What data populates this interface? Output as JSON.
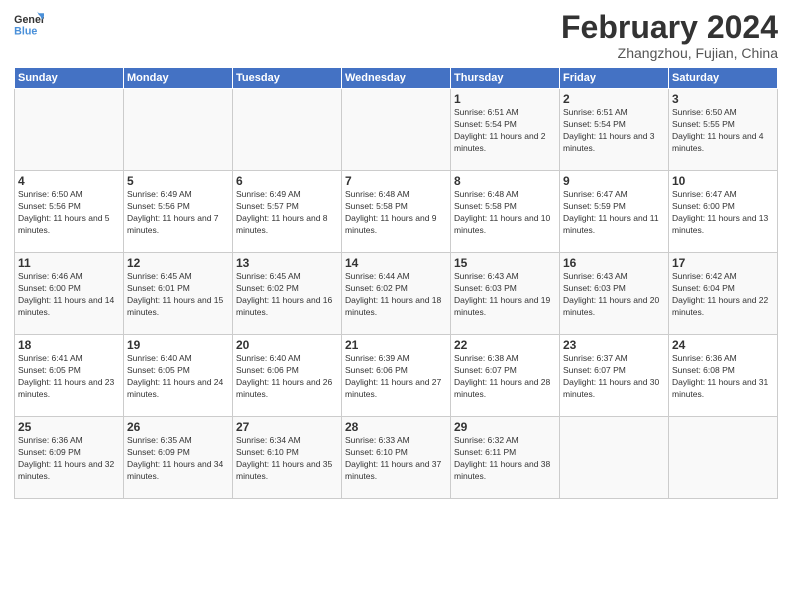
{
  "header": {
    "logo_general": "General",
    "logo_blue": "Blue",
    "title": "February 2024",
    "subtitle": "Zhangzhou, Fujian, China"
  },
  "calendar": {
    "days_of_week": [
      "Sunday",
      "Monday",
      "Tuesday",
      "Wednesday",
      "Thursday",
      "Friday",
      "Saturday"
    ],
    "weeks": [
      [
        {
          "day": "",
          "info": ""
        },
        {
          "day": "",
          "info": ""
        },
        {
          "day": "",
          "info": ""
        },
        {
          "day": "",
          "info": ""
        },
        {
          "day": "1",
          "info": "Sunrise: 6:51 AM\nSunset: 5:54 PM\nDaylight: 11 hours and 2 minutes."
        },
        {
          "day": "2",
          "info": "Sunrise: 6:51 AM\nSunset: 5:54 PM\nDaylight: 11 hours and 3 minutes."
        },
        {
          "day": "3",
          "info": "Sunrise: 6:50 AM\nSunset: 5:55 PM\nDaylight: 11 hours and 4 minutes."
        }
      ],
      [
        {
          "day": "4",
          "info": "Sunrise: 6:50 AM\nSunset: 5:56 PM\nDaylight: 11 hours and 5 minutes."
        },
        {
          "day": "5",
          "info": "Sunrise: 6:49 AM\nSunset: 5:56 PM\nDaylight: 11 hours and 7 minutes."
        },
        {
          "day": "6",
          "info": "Sunrise: 6:49 AM\nSunset: 5:57 PM\nDaylight: 11 hours and 8 minutes."
        },
        {
          "day": "7",
          "info": "Sunrise: 6:48 AM\nSunset: 5:58 PM\nDaylight: 11 hours and 9 minutes."
        },
        {
          "day": "8",
          "info": "Sunrise: 6:48 AM\nSunset: 5:58 PM\nDaylight: 11 hours and 10 minutes."
        },
        {
          "day": "9",
          "info": "Sunrise: 6:47 AM\nSunset: 5:59 PM\nDaylight: 11 hours and 11 minutes."
        },
        {
          "day": "10",
          "info": "Sunrise: 6:47 AM\nSunset: 6:00 PM\nDaylight: 11 hours and 13 minutes."
        }
      ],
      [
        {
          "day": "11",
          "info": "Sunrise: 6:46 AM\nSunset: 6:00 PM\nDaylight: 11 hours and 14 minutes."
        },
        {
          "day": "12",
          "info": "Sunrise: 6:45 AM\nSunset: 6:01 PM\nDaylight: 11 hours and 15 minutes."
        },
        {
          "day": "13",
          "info": "Sunrise: 6:45 AM\nSunset: 6:02 PM\nDaylight: 11 hours and 16 minutes."
        },
        {
          "day": "14",
          "info": "Sunrise: 6:44 AM\nSunset: 6:02 PM\nDaylight: 11 hours and 18 minutes."
        },
        {
          "day": "15",
          "info": "Sunrise: 6:43 AM\nSunset: 6:03 PM\nDaylight: 11 hours and 19 minutes."
        },
        {
          "day": "16",
          "info": "Sunrise: 6:43 AM\nSunset: 6:03 PM\nDaylight: 11 hours and 20 minutes."
        },
        {
          "day": "17",
          "info": "Sunrise: 6:42 AM\nSunset: 6:04 PM\nDaylight: 11 hours and 22 minutes."
        }
      ],
      [
        {
          "day": "18",
          "info": "Sunrise: 6:41 AM\nSunset: 6:05 PM\nDaylight: 11 hours and 23 minutes."
        },
        {
          "day": "19",
          "info": "Sunrise: 6:40 AM\nSunset: 6:05 PM\nDaylight: 11 hours and 24 minutes."
        },
        {
          "day": "20",
          "info": "Sunrise: 6:40 AM\nSunset: 6:06 PM\nDaylight: 11 hours and 26 minutes."
        },
        {
          "day": "21",
          "info": "Sunrise: 6:39 AM\nSunset: 6:06 PM\nDaylight: 11 hours and 27 minutes."
        },
        {
          "day": "22",
          "info": "Sunrise: 6:38 AM\nSunset: 6:07 PM\nDaylight: 11 hours and 28 minutes."
        },
        {
          "day": "23",
          "info": "Sunrise: 6:37 AM\nSunset: 6:07 PM\nDaylight: 11 hours and 30 minutes."
        },
        {
          "day": "24",
          "info": "Sunrise: 6:36 AM\nSunset: 6:08 PM\nDaylight: 11 hours and 31 minutes."
        }
      ],
      [
        {
          "day": "25",
          "info": "Sunrise: 6:36 AM\nSunset: 6:09 PM\nDaylight: 11 hours and 32 minutes."
        },
        {
          "day": "26",
          "info": "Sunrise: 6:35 AM\nSunset: 6:09 PM\nDaylight: 11 hours and 34 minutes."
        },
        {
          "day": "27",
          "info": "Sunrise: 6:34 AM\nSunset: 6:10 PM\nDaylight: 11 hours and 35 minutes."
        },
        {
          "day": "28",
          "info": "Sunrise: 6:33 AM\nSunset: 6:10 PM\nDaylight: 11 hours and 37 minutes."
        },
        {
          "day": "29",
          "info": "Sunrise: 6:32 AM\nSunset: 6:11 PM\nDaylight: 11 hours and 38 minutes."
        },
        {
          "day": "",
          "info": ""
        },
        {
          "day": "",
          "info": ""
        }
      ]
    ]
  }
}
